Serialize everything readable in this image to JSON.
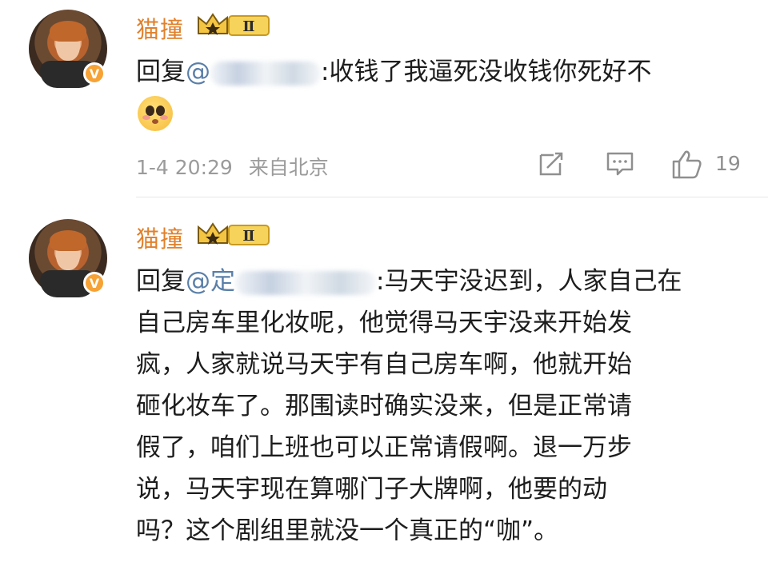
{
  "comments": [
    {
      "username": "猫撞",
      "level": "Ⅱ",
      "reply_prefix": "回复",
      "mention": "@",
      "separator": ":",
      "text": "收钱了我逼死没收钱你死好不",
      "emoji": "pleading-face",
      "time": "1-4 20:29",
      "source": "来自北京",
      "like_count": "19"
    },
    {
      "username": "猫撞",
      "level": "Ⅱ",
      "reply_prefix": "回复",
      "mention": "@定",
      "separator": ":",
      "line1": "马天宇没迟到，人家自己在",
      "lines": [
        "自己房车里化妆呢，他觉得马天宇没来开始发",
        "疯，人家就说马天宇有自己房车啊，他就开始",
        "砸化妆车了。那围读时确实没来，但是正常请",
        "假了，咱们上班也可以正常请假啊。退一万步",
        "说，马天宇现在算哪门子大牌啊，他要的动",
        "吗？这个剧组里就没一个真正的“咖”。"
      ]
    }
  ],
  "colors": {
    "username": "#e0812c",
    "mention": "#5a7fa8",
    "meta": "#9b9b9b",
    "verified": "#f7a234"
  },
  "icons": [
    "crown-level-badge",
    "verified-v-icon",
    "share-icon",
    "comment-icon",
    "like-thumb-icon"
  ]
}
